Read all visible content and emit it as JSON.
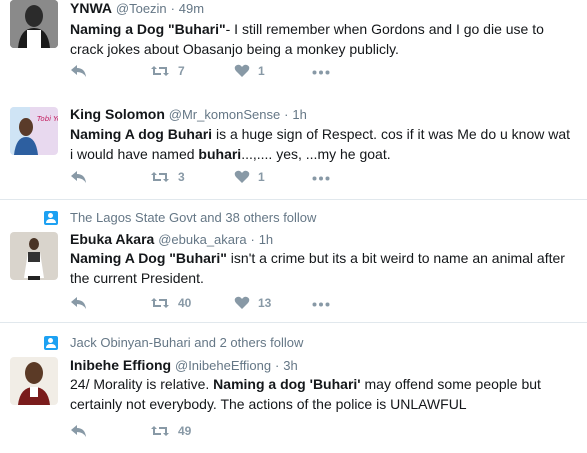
{
  "tweets": [
    {
      "name": "YNWA",
      "handle": "@Toezin",
      "time": "49m",
      "text_parts": [
        "",
        "Naming a Dog \"Buhari\"",
        "- I still remember when Gordons and I go die use to crack jokes about Obasanjo being a monkey publicly."
      ],
      "retweets": "7",
      "likes": "1"
    },
    {
      "name": "King Solomon",
      "handle": "@Mr_komonSense",
      "time": "1h",
      "text_parts": [
        "",
        "Naming A dog Buhari",
        " is a huge sign of Respect. cos if it was Me do u know wat i would have named ",
        "buhari",
        "...,.... yes, ...my he goat."
      ],
      "retweets": "3",
      "likes": "1"
    },
    {
      "context": "The Lagos State Govt and 38 others follow",
      "name": "Ebuka Akara",
      "handle": "@ebuka_akara",
      "time": "1h",
      "text_parts": [
        "",
        "Naming A Dog \"Buhari\"",
        " isn't a crime but its a bit weird to name an animal after the current President."
      ],
      "retweets": "40",
      "likes": "13"
    },
    {
      "context": "Jack Obinyan-Buhari and 2 others follow",
      "name": "Inibehe Effiong",
      "handle": "@InibeheEffiong",
      "time": "3h",
      "text_parts": [
        "24/ Morality is relative. ",
        "Naming a dog 'Buhari'",
        " may offend some people but certainly not everybody. The actions of the police is UNLAWFUL"
      ],
      "retweets": "49",
      "likes": ""
    }
  ],
  "avatar2_text": "Tobi You",
  "colors": {
    "accent": "#1da1f2",
    "muted": "#657786",
    "icon": "#8899a6",
    "border": "#e1e8ed"
  }
}
